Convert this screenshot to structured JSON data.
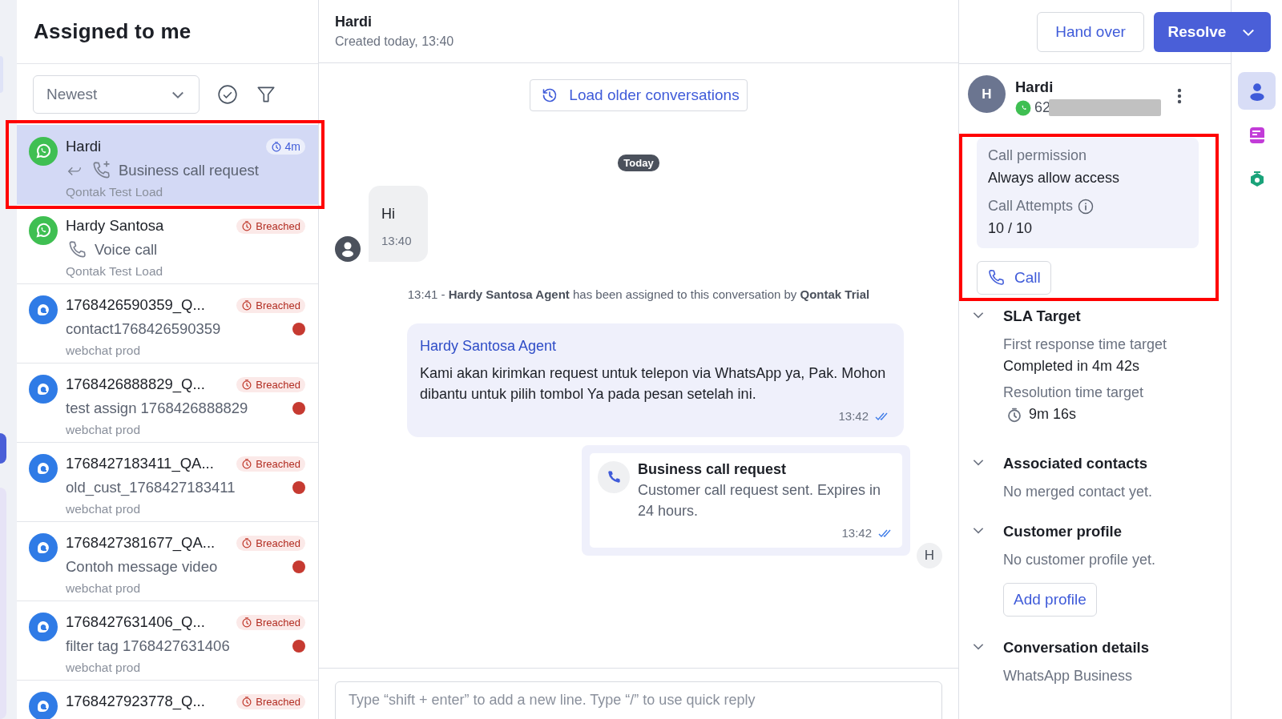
{
  "inbox_list": {
    "title": "Assigned to me",
    "sort": "Newest"
  },
  "conversations": [
    {
      "avatar": {
        "kind": "whatsapp"
      },
      "name": "Hardi",
      "badge": {
        "kind": "timer",
        "text": "4m"
      },
      "preview": {
        "kind": "call_request",
        "text": "Business call request"
      },
      "inbox": "Qontak Test Load",
      "unread": false,
      "selected": true,
      "highlighted": true
    },
    {
      "avatar": {
        "kind": "whatsapp"
      },
      "name": "Hardy Santosa",
      "badge": {
        "kind": "breached",
        "text": "Breached"
      },
      "preview": {
        "kind": "voice_call",
        "text": "Voice call"
      },
      "inbox": "Qontak Test Load",
      "unread": false,
      "selected": false,
      "highlighted": false
    },
    {
      "avatar": {
        "kind": "webchat"
      },
      "name": "1768426590359_Q...",
      "badge": {
        "kind": "breached",
        "text": "Breached"
      },
      "preview": {
        "kind": "text",
        "text": "contact1768426590359"
      },
      "inbox": "webchat prod",
      "unread": true,
      "selected": false,
      "highlighted": false
    },
    {
      "avatar": {
        "kind": "webchat"
      },
      "name": "1768426888829_Q...",
      "badge": {
        "kind": "breached",
        "text": "Breached"
      },
      "preview": {
        "kind": "text",
        "text": "test assign 1768426888829"
      },
      "inbox": "webchat prod",
      "unread": true,
      "selected": false,
      "highlighted": false
    },
    {
      "avatar": {
        "kind": "webchat"
      },
      "name": "1768427183411_QA...",
      "badge": {
        "kind": "breached",
        "text": "Breached"
      },
      "preview": {
        "kind": "text",
        "text": "old_cust_1768427183411"
      },
      "inbox": "webchat prod",
      "unread": true,
      "selected": false,
      "highlighted": false
    },
    {
      "avatar": {
        "kind": "webchat"
      },
      "name": "1768427381677_QA...",
      "badge": {
        "kind": "breached",
        "text": "Breached"
      },
      "preview": {
        "kind": "text",
        "text": "Contoh message video"
      },
      "inbox": "webchat prod",
      "unread": true,
      "selected": false,
      "highlighted": false
    },
    {
      "avatar": {
        "kind": "webchat"
      },
      "name": "1768427631406_Q...",
      "badge": {
        "kind": "breached",
        "text": "Breached"
      },
      "preview": {
        "kind": "text",
        "text": "filter tag 1768427631406"
      },
      "inbox": "webchat prod",
      "unread": true,
      "selected": false,
      "highlighted": false
    },
    {
      "avatar": {
        "kind": "webchat"
      },
      "name": "1768427923778_Q...",
      "badge": {
        "kind": "breached",
        "text": "Breached"
      },
      "selected": false
    }
  ],
  "chat": {
    "name": "Hardi",
    "created": "Created today, 13:40",
    "hand_over": "Hand over",
    "resolve": "Resolve",
    "load_older": "Load older conversations",
    "date_chip": "Today",
    "messages": [
      {
        "kind": "incoming",
        "text": "Hi",
        "time": "13:40"
      },
      {
        "kind": "system",
        "text": "13:41 - **Hardy Santosa Agent** has been assigned to this conversation by **Qontak Trial**"
      },
      {
        "kind": "outgoing",
        "sender": "Hardy Santosa Agent",
        "text": "Kami akan kirimkan request untuk telepon via WhatsApp ya, Pak. Mohon dibantu untuk pilih tombol Ya pada pesan setelah ini.",
        "time": "13:42",
        "read": true
      },
      {
        "kind": "call_request",
        "title": "Business call request",
        "text": "Customer call request sent. Expires in 24 hours.",
        "time": "13:42",
        "read": true,
        "avatar": "H"
      }
    ],
    "composer": {
      "placeholder": "Type “shift + enter” to add a new line. Type “/” to use quick reply"
    }
  },
  "contact": {
    "avatar": "H",
    "name": "Hardi",
    "phone": "62",
    "call_card": {
      "highlighted": true,
      "permission_label": "Call permission",
      "permission_value": "Always allow access",
      "attempts_label": "Call Attempts",
      "attempts_value": "10 / 10",
      "call_button": "Call"
    },
    "sections": [
      {
        "title": "SLA Target",
        "expanded": true,
        "items": [
          {
            "kind": "field",
            "label": "First response time target",
            "value": "Completed in 4m 42s"
          },
          {
            "kind": "timer",
            "label": "Resolution time target",
            "value": "9m 16s"
          }
        ]
      },
      {
        "title": "Associated contacts",
        "expanded": true,
        "items": [
          {
            "kind": "note",
            "text": "No merged contact yet."
          }
        ]
      },
      {
        "title": "Customer profile",
        "expanded": true,
        "items": [
          {
            "kind": "note",
            "text": "No customer profile yet."
          },
          {
            "kind": "button",
            "text": "Add profile"
          }
        ]
      },
      {
        "title": "Conversation details",
        "expanded": true,
        "items": [
          {
            "kind": "note",
            "text": "WhatsApp Business"
          }
        ]
      }
    ]
  },
  "side_tabs": [
    {
      "kind": "contact",
      "selected": true
    },
    {
      "kind": "notes",
      "selected": false
    },
    {
      "kind": "bot",
      "selected": false
    }
  ]
}
